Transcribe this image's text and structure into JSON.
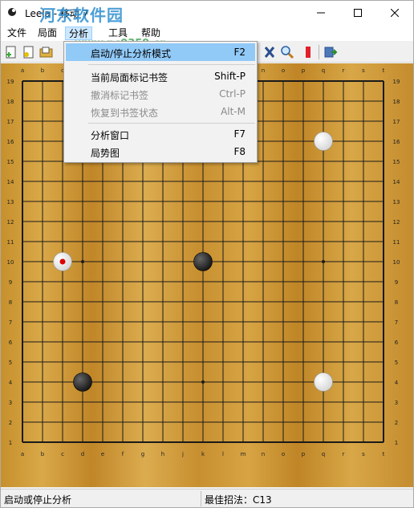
{
  "window": {
    "title": "Leela - 移动 7",
    "watermark": "河东软件园",
    "watermark_url": "www.pc0359.cn"
  },
  "menubar": {
    "items": [
      {
        "label": "文件"
      },
      {
        "label": "局面"
      },
      {
        "label": "分析"
      },
      {
        "label": "工具"
      },
      {
        "label": "帮助"
      }
    ]
  },
  "dropdown": {
    "items": [
      {
        "label": "启动/停止分析模式",
        "shortcut": "F2",
        "state": "highlighted"
      },
      {
        "label": "当前局面标记书签",
        "shortcut": "Shift-P",
        "state": "enabled"
      },
      {
        "label": "撤消标记书签",
        "shortcut": "Ctrl-P",
        "state": "disabled"
      },
      {
        "label": "恢复到书签状态",
        "shortcut": "Alt-M",
        "state": "disabled"
      },
      {
        "label": "分析窗口",
        "shortcut": "F7",
        "state": "enabled"
      },
      {
        "label": "局势图",
        "shortcut": "F8",
        "state": "enabled"
      }
    ]
  },
  "board": {
    "size": 19,
    "column_labels": [
      "a",
      "b",
      "c",
      "d",
      "e",
      "f",
      "g",
      "h",
      "j",
      "k",
      "l",
      "m",
      "n",
      "o",
      "p",
      "q",
      "r",
      "s",
      "t"
    ],
    "row_labels": [
      "19",
      "18",
      "17",
      "16",
      "15",
      "14",
      "13",
      "12",
      "11",
      "10",
      "9",
      "8",
      "7",
      "6",
      "5",
      "4",
      "3",
      "2",
      "1"
    ],
    "hoshi": [
      [
        4,
        4
      ],
      [
        10,
        4
      ],
      [
        16,
        4
      ],
      [
        4,
        10
      ],
      [
        10,
        10
      ],
      [
        16,
        10
      ],
      [
        4,
        16
      ],
      [
        10,
        16
      ],
      [
        16,
        16
      ]
    ],
    "stones": [
      {
        "color": "white",
        "col": 16,
        "row": 16
      },
      {
        "color": "black",
        "col": 10,
        "row": 10
      },
      {
        "color": "white",
        "col": 3,
        "row": 10,
        "last_move": true
      },
      {
        "color": "black",
        "col": 4,
        "row": 4
      },
      {
        "color": "white",
        "col": 16,
        "row": 4
      }
    ],
    "colors": {
      "black_stone": "#1a1a1a",
      "white_stone": "#f8f8f8",
      "last_move_marker": "#dd0000",
      "grid": "#1a1a1a"
    }
  },
  "statusbar": {
    "left": "启动或停止分析",
    "right": "最佳招法：C13"
  },
  "colors": {
    "menu_highlight": "#91c9f7",
    "menu_open": "#cce8ff"
  }
}
